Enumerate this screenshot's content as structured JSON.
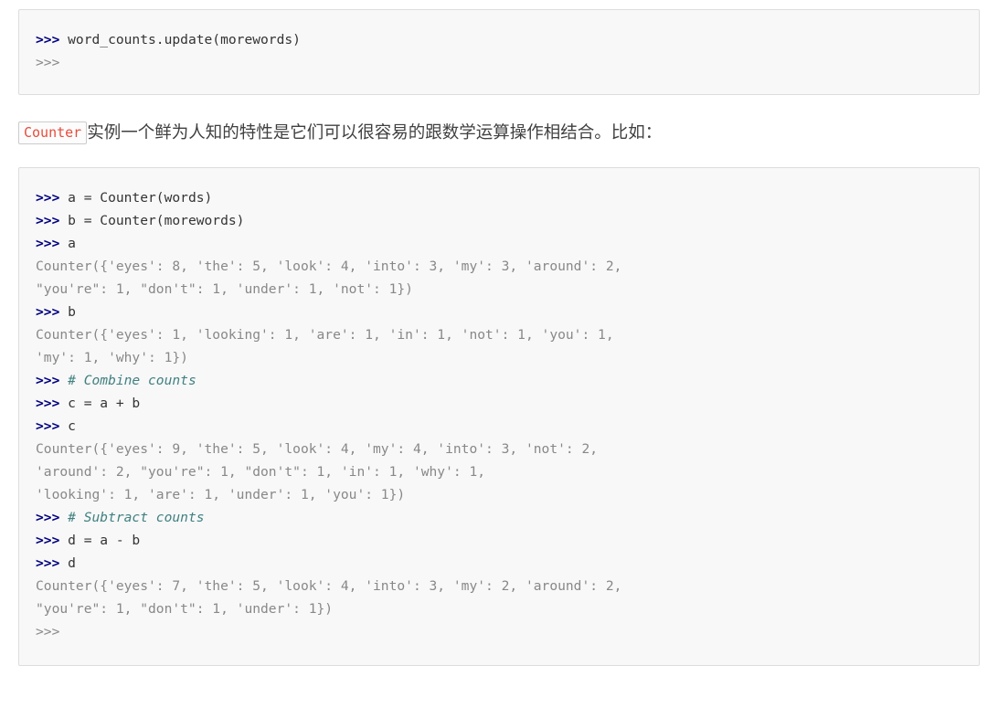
{
  "block1": {
    "name": "python-repl-update-example",
    "lines": [
      {
        "prompt": ">>>",
        "prompt_style": "bold",
        "code": " word_counts.update(morewords)",
        "style": "src"
      },
      {
        "prompt": ">>>",
        "prompt_style": "dim",
        "code": "",
        "style": "src"
      }
    ]
  },
  "paragraph": {
    "inline_code": "Counter",
    "text": "实例一个鲜为人知的特性是它们可以很容易的跟数学运算操作相结合。比如："
  },
  "block2": {
    "name": "python-repl-counter-math-example",
    "lines": [
      {
        "prompt": ">>>",
        "prompt_style": "bold",
        "code": " a = Counter(words)",
        "style": "src"
      },
      {
        "prompt": ">>>",
        "prompt_style": "bold",
        "code": " b = Counter(morewords)",
        "style": "src"
      },
      {
        "prompt": ">>>",
        "prompt_style": "bold",
        "code": " a",
        "style": "src"
      },
      {
        "prompt": "",
        "prompt_style": "none",
        "code": "Counter({'eyes': 8, 'the': 5, 'look': 4, 'into': 3, 'my': 3, 'around': 2,",
        "style": "out"
      },
      {
        "prompt": "",
        "prompt_style": "none",
        "code": "\"you're\": 1, \"don't\": 1, 'under': 1, 'not': 1})",
        "style": "out"
      },
      {
        "prompt": ">>>",
        "prompt_style": "bold",
        "code": " b",
        "style": "src"
      },
      {
        "prompt": "",
        "prompt_style": "none",
        "code": "Counter({'eyes': 1, 'looking': 1, 'are': 1, 'in': 1, 'not': 1, 'you': 1,",
        "style": "out"
      },
      {
        "prompt": "",
        "prompt_style": "none",
        "code": "'my': 1, 'why': 1})",
        "style": "out"
      },
      {
        "prompt": ">>>",
        "prompt_style": "bold",
        "code": " # Combine counts",
        "style": "cm"
      },
      {
        "prompt": ">>>",
        "prompt_style": "bold",
        "code": " c = a + b",
        "style": "src"
      },
      {
        "prompt": ">>>",
        "prompt_style": "bold",
        "code": " c",
        "style": "src"
      },
      {
        "prompt": "",
        "prompt_style": "none",
        "code": "Counter({'eyes': 9, 'the': 5, 'look': 4, 'my': 4, 'into': 3, 'not': 2,",
        "style": "out"
      },
      {
        "prompt": "",
        "prompt_style": "none",
        "code": "'around': 2, \"you're\": 1, \"don't\": 1, 'in': 1, 'why': 1,",
        "style": "out"
      },
      {
        "prompt": "",
        "prompt_style": "none",
        "code": "'looking': 1, 'are': 1, 'under': 1, 'you': 1})",
        "style": "out"
      },
      {
        "prompt": ">>>",
        "prompt_style": "bold",
        "code": " # Subtract counts",
        "style": "cm"
      },
      {
        "prompt": ">>>",
        "prompt_style": "bold",
        "code": " d = a - b",
        "style": "src"
      },
      {
        "prompt": ">>>",
        "prompt_style": "bold",
        "code": " d",
        "style": "src"
      },
      {
        "prompt": "",
        "prompt_style": "none",
        "code": "Counter({'eyes': 7, 'the': 5, 'look': 4, 'into': 3, 'my': 2, 'around': 2,",
        "style": "out"
      },
      {
        "prompt": "",
        "prompt_style": "none",
        "code": "\"you're\": 1, \"don't\": 1, 'under': 1})",
        "style": "out"
      },
      {
        "prompt": ">>>",
        "prompt_style": "dim",
        "code": "",
        "style": "src"
      }
    ]
  },
  "colors": {
    "code_bg": "#f8f8f8",
    "code_border": "#dddddd",
    "prompt": "#000080",
    "prompt_dim": "#888888",
    "source": "#333333",
    "output": "#888888",
    "comment": "#408080",
    "inline_code_text": "#e74c3c",
    "body_text": "#404040"
  }
}
